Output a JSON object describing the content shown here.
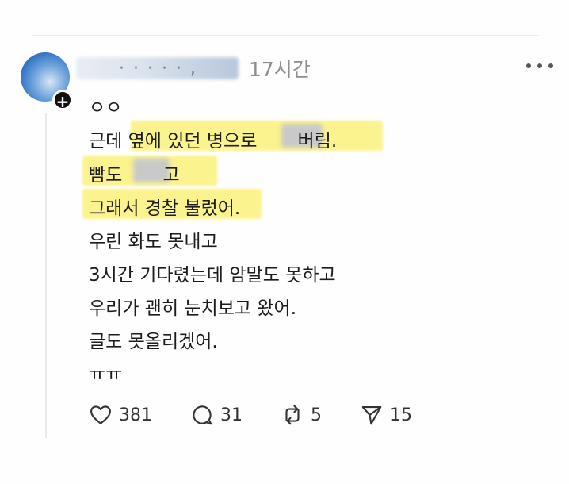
{
  "post": {
    "username": "· ·  · · ·  ,",
    "timestamp": "17시간",
    "follow_symbol": "+",
    "lines": [
      "ㅇㅇ",
      "근데 옆에 있던 병으로       버림.",
      "빰도       고",
      "그래서 경찰 불렀어.",
      "우린 화도 못내고",
      "3시간 기다렸는데 암말도 못하고",
      "우리가 괜히 눈치보고 왔어.",
      "글도 못올리겠어.",
      "ㅠㅠ"
    ]
  },
  "actions": {
    "likes": "381",
    "comments": "31",
    "reposts": "5",
    "shares": "15"
  },
  "icons": [
    "heart-icon",
    "comment-icon",
    "repost-icon",
    "share-icon",
    "more-icon",
    "plus-icon"
  ]
}
